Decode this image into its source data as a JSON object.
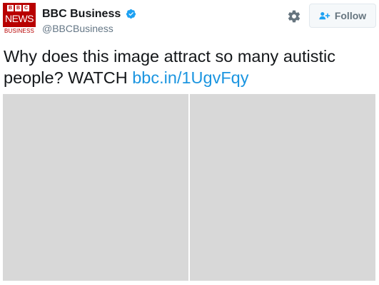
{
  "account": {
    "display_name": "BBC Business",
    "handle": "@BBCBusiness",
    "verified": true,
    "avatar": {
      "blocks": [
        "B",
        "B",
        "C"
      ],
      "news_text": "NEWS",
      "sub_text": "BUSINESS",
      "brand_color": "#b80000"
    }
  },
  "actions": {
    "settings_icon": "gear-icon",
    "follow_icon": "add-user-icon",
    "follow_label": "Follow"
  },
  "tweet": {
    "text": "Why does this image attract so many autistic people? WATCH ",
    "link": "bbc.in/1UgvFqy",
    "link_color": "#1b95e0"
  },
  "media": {
    "panels": [
      "left-image",
      "right-image"
    ],
    "placeholder_color": "#d8d8d8"
  }
}
